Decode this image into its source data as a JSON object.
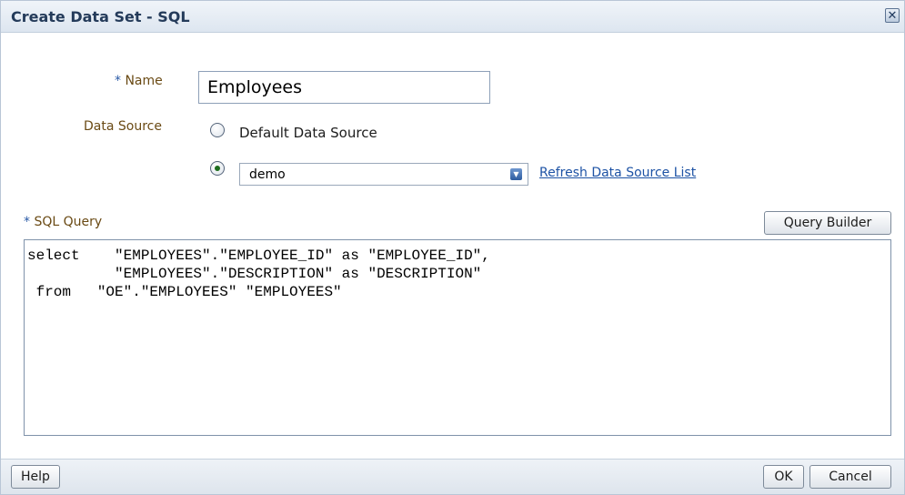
{
  "dialog": {
    "title": "Create Data Set - SQL",
    "close_icon": "close-icon"
  },
  "form": {
    "name_required_mark": "*",
    "name_label": "Name",
    "name_value": "Employees",
    "data_source_label": "Data Source",
    "default_source_option": "Default Data Source",
    "default_source_selected": false,
    "selected_source_option_selected": true,
    "data_source_select_value": "demo",
    "refresh_link": "Refresh Data Source List",
    "sql_required_mark": "*",
    "sql_label": "SQL Query",
    "query_builder_button": "Query Builder",
    "sql_text": "select    \"EMPLOYEES\".\"EMPLOYEE_ID\" as \"EMPLOYEE_ID\",\n          \"EMPLOYEES\".\"DESCRIPTION\" as \"DESCRIPTION\"\n from   \"OE\".\"EMPLOYEES\" \"EMPLOYEES\""
  },
  "footer": {
    "help_button": "Help",
    "ok_button": "OK",
    "cancel_button": "Cancel"
  },
  "colors": {
    "title_text": "#243b5a",
    "label_text": "#6a4a14",
    "required_mark": "#2a5aa6",
    "link": "#1e53a5",
    "radio_selected": "#1e6d1e"
  }
}
